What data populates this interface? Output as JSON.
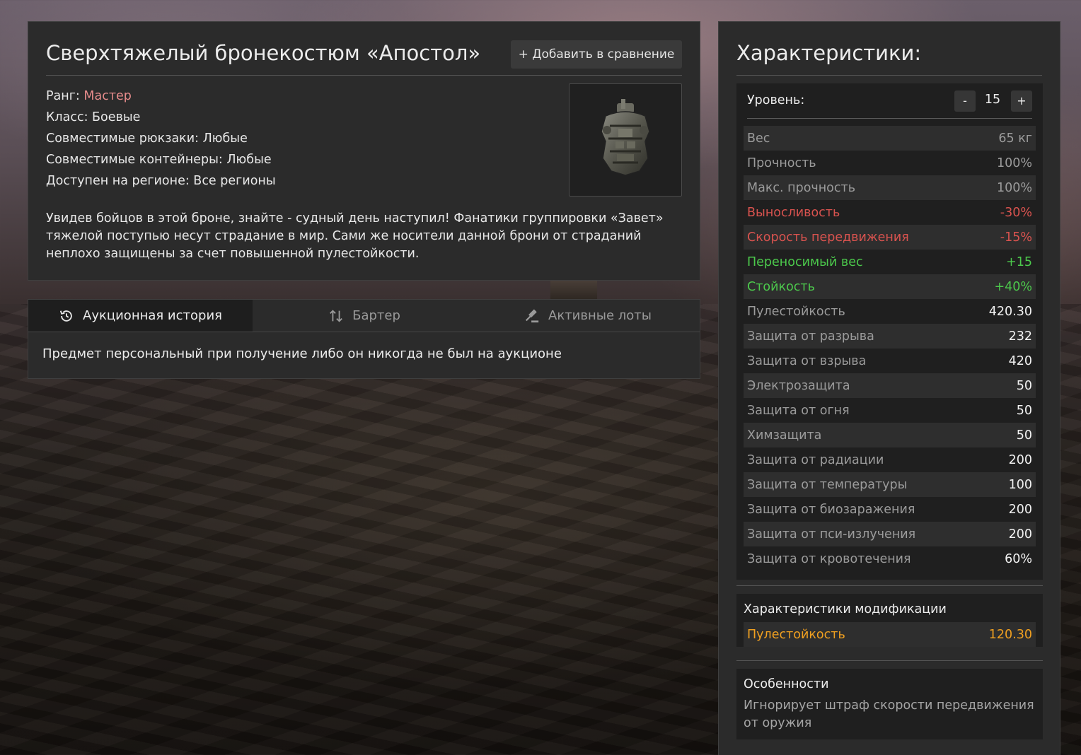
{
  "item": {
    "title": "Сверхтяжелый бронекостюм «Апостол»",
    "compare_button": "+ Добавить в сравнение",
    "rank_label": "Ранг: ",
    "rank_value": "Мастер",
    "class": "Класс: Боевые",
    "backpacks": "Совместимые рюкзаки: Любые",
    "containers": "Совместимые контейнеры: Любые",
    "region": "Доступен на регионе: Все регионы",
    "description": "Увидев бойцов в этой броне, знайте - судный день наступил! Фанатики группировки «Завет» тяжелой поступью несут страдание в мир. Сами же носители данной брони от страданий неплохо защищены за счет повышенной пулестойкости.",
    "image_icon": "armor-suit-image"
  },
  "auction": {
    "tabs": [
      {
        "label": "Аукционная история",
        "icon": "history-icon"
      },
      {
        "label": "Бартер",
        "icon": "swap-icon"
      },
      {
        "label": "Активные лоты",
        "icon": "gavel-icon"
      }
    ],
    "message": "Предмет персональный при получение либо он никогда не был на аукционе"
  },
  "stats": {
    "title": "Характеристики:",
    "level_label": "Уровень:",
    "level_minus": "-",
    "level_value": "15",
    "level_plus": "+",
    "rows": [
      {
        "name": "Вес",
        "value": "65 кг"
      },
      {
        "name": "Прочность",
        "value": "100%"
      },
      {
        "name": "Макс. прочность",
        "value": "100%"
      },
      {
        "name": "Выносливость",
        "value": "-30%"
      },
      {
        "name": "Скорость передвижения",
        "value": "-15%"
      },
      {
        "name": "Переносимый вес",
        "value": "+15"
      },
      {
        "name": "Стойкость",
        "value": "+40%"
      },
      {
        "name": "Пулестойкость",
        "value": "420.30"
      },
      {
        "name": "Защита от разрыва",
        "value": "232"
      },
      {
        "name": "Защита от взрыва",
        "value": "420"
      },
      {
        "name": "Электрозащита",
        "value": "50"
      },
      {
        "name": "Защита от огня",
        "value": "50"
      },
      {
        "name": "Химзащита",
        "value": "50"
      },
      {
        "name": "Защита от радиации",
        "value": "200"
      },
      {
        "name": "Защита от температуры",
        "value": "100"
      },
      {
        "name": "Защита от биозаражения",
        "value": "200"
      },
      {
        "name": "Защита от пси-излучения",
        "value": "200"
      },
      {
        "name": "Защита от кровотечения",
        "value": "60%"
      }
    ],
    "mod_title": "Характеристики модификации",
    "mod_row": {
      "name": "Пулестойкость",
      "value": "120.30"
    },
    "features_title": "Особенности",
    "features_text": "Игнорирует штраф скорости передвижения от оружия"
  },
  "colors": {
    "negative": "#d9534f",
    "positive": "#4cc94c",
    "modification": "#f0a020",
    "rank": "#e78c8c"
  }
}
